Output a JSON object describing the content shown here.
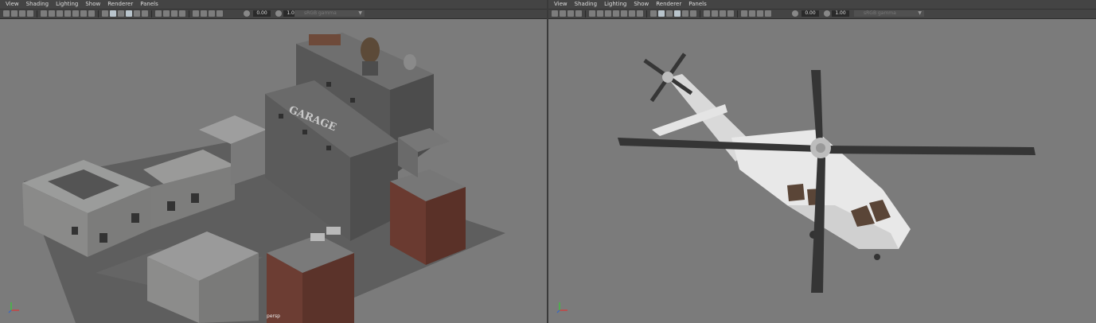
{
  "menu": [
    "View",
    "Shading",
    "Lighting",
    "Show",
    "Renderer",
    "Panels"
  ],
  "toolbar": {
    "exposure": "0.00",
    "gamma": "1.00",
    "colorspace": "sRGB gamma"
  },
  "left_viewport": {
    "camera": "persp",
    "sign_text": "GARAGE"
  },
  "right_viewport": {
    "camera": ""
  },
  "colors": {
    "viewport_bg": "#7b7b7b",
    "menubar_bg": "#444444",
    "rotor": "#353535",
    "fuselage": "#e6e6e6"
  },
  "icons": [
    "camera-icon",
    "grid-icon",
    "wireframe-icon",
    "smooth-shade-icon",
    "texture-icon",
    "light-icon",
    "shadow-icon",
    "xray-icon",
    "isolate-icon",
    "exposure-icon",
    "gamma-icon",
    "axis-icon"
  ]
}
